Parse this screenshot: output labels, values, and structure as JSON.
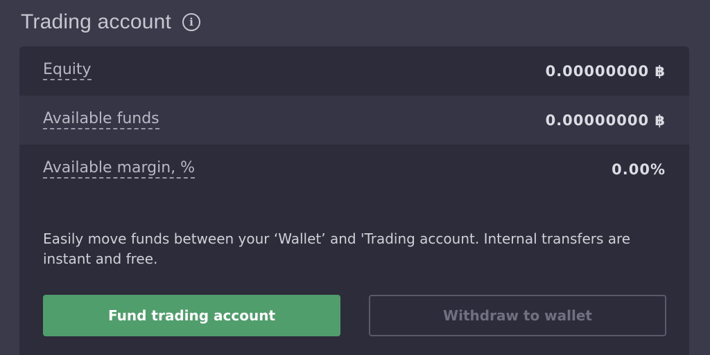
{
  "header": {
    "title": "Trading account",
    "info_icon": "info-circle-icon"
  },
  "account": {
    "rows": [
      {
        "label": "Equity",
        "value": "0.00000000 ฿"
      },
      {
        "label": "Available funds",
        "value": "0.00000000 ฿"
      },
      {
        "label": "Available margin, %",
        "value": "0.00%"
      }
    ]
  },
  "description": "Easily move funds between your ‘Wallet’ and 'Trading account. Internal transfers are instant and free.",
  "buttons": {
    "fund_label": "Fund trading account",
    "withdraw_label": "Withdraw to wallet"
  },
  "colors": {
    "background": "#3a3a4a",
    "card": "#2c2c3a",
    "primary": "#4f9e6b"
  }
}
